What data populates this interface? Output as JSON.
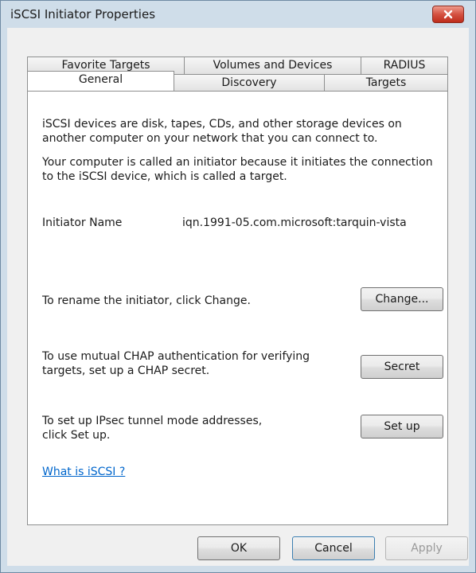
{
  "window": {
    "title": "iSCSI Initiator Properties"
  },
  "tabs": {
    "row1": [
      "Favorite Targets",
      "Volumes and Devices",
      "RADIUS"
    ],
    "row2": [
      "General",
      "Discovery",
      "Targets"
    ]
  },
  "general": {
    "intro1": "iSCSI devices are disk, tapes, CDs, and other storage devices on another computer on your network that you can connect to.",
    "intro2": "Your computer is called an initiator because it initiates the connection to the iSCSI device, which is called a target.",
    "initiator_label": "Initiator Name",
    "initiator_value": "iqn.1991-05.com.microsoft:tarquin-vista",
    "rename_text": "To rename the initiator, click Change.",
    "change_button": "Change...",
    "chap_text": "To use mutual CHAP authentication for verifying targets, set up a CHAP secret.",
    "secret_button": "Secret",
    "ipsec_text": "To set up IPsec tunnel mode addresses, click Set up.",
    "setup_button": "Set up",
    "help_link": "What is iSCSI ?"
  },
  "footer": {
    "ok": "OK",
    "cancel": "Cancel",
    "apply": "Apply"
  },
  "icons": {
    "close": "close-icon"
  }
}
